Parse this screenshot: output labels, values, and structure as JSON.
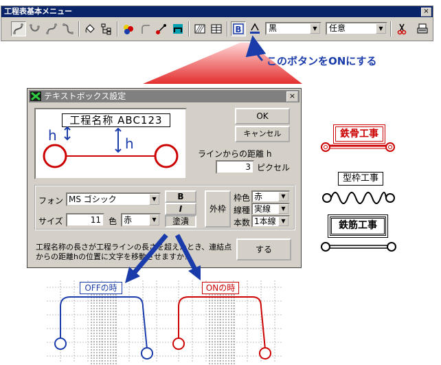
{
  "toolbar": {
    "title": "工程表基本メニュー",
    "close_glyph": "×",
    "color_select": "黒",
    "option_select": "任意"
  },
  "callout": "このボタンをONにする",
  "dialog": {
    "title": "テキストボックス設定",
    "close_glyph": "×",
    "preview_label": "工程名称 ABC123",
    "preview_h_left": "h",
    "preview_h_right": "h",
    "ok_label": "OK",
    "cancel_label": "キャンセル",
    "distance_label": "ラインからの距離 h",
    "distance_value": "3",
    "distance_unit": "ピクセル",
    "font_label": "フォント",
    "font_value": "MS ゴシック",
    "size_label": "サイズ",
    "size_value": "11",
    "color_label": "色",
    "color_value": "赤",
    "bold_label": "B",
    "italic_label": "I",
    "fill_label": "塗潰",
    "frame_label": "外枠",
    "frame_color_label": "枠色",
    "frame_color_value": "赤",
    "line_type_label": "線種",
    "line_type_value": "実線",
    "line_count_label": "本数",
    "line_count_value": "1本線",
    "question_line1": "工程名称の長さが工程ラインの長さを超えたとき、連結点",
    "question_line2": "からの距離hの位置に文字を移動させますか？",
    "do_button": "する"
  },
  "examples": {
    "steel_frame": "鉄骨工事",
    "formwork": "型枠工事",
    "rebar": "鉄筋工事"
  },
  "grids": {
    "off_label": "OFFの時",
    "on_label": "ONの時"
  },
  "colors": {
    "red": "#cc0000",
    "blue": "#1a3caa",
    "titlebar": "#0a246a",
    "face": "#d4d0c8"
  }
}
